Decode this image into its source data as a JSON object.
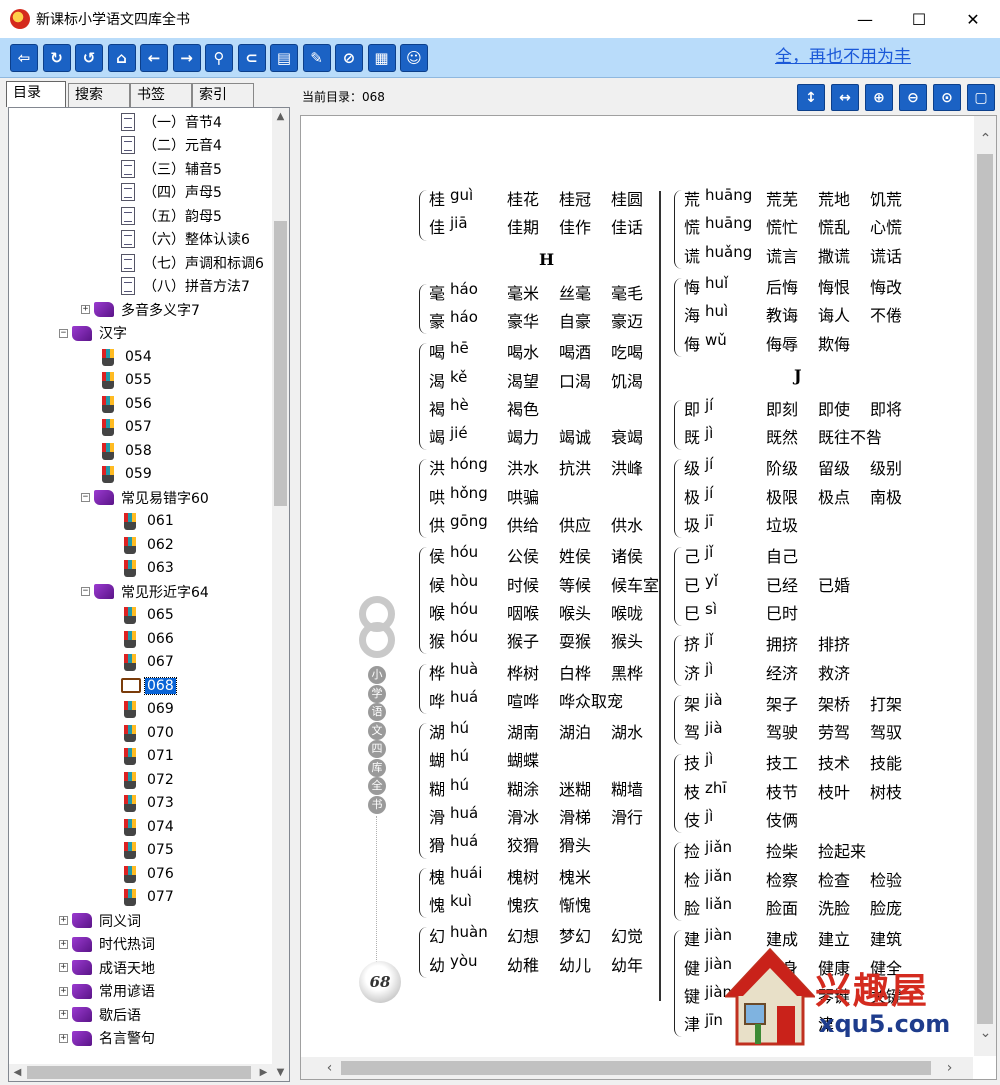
{
  "window": {
    "title": "新课标小学语文四库全书",
    "minimize": "—",
    "maximize": "☐",
    "close": "✕"
  },
  "toolbar": {
    "buttons": [
      {
        "name": "exit",
        "glyph": "⇦"
      },
      {
        "name": "refresh",
        "glyph": "↻"
      },
      {
        "name": "undo",
        "glyph": "↺"
      },
      {
        "name": "home",
        "glyph": "⌂"
      },
      {
        "name": "back",
        "glyph": "←"
      },
      {
        "name": "forward",
        "glyph": "→"
      },
      {
        "name": "search",
        "glyph": "⚲"
      },
      {
        "name": "bookmark",
        "glyph": "⊂"
      },
      {
        "name": "note",
        "glyph": "▤"
      },
      {
        "name": "edit",
        "glyph": "✎"
      },
      {
        "name": "link",
        "glyph": "⊘"
      },
      {
        "name": "print",
        "glyph": "▦"
      },
      {
        "name": "about",
        "glyph": "☺"
      }
    ],
    "marquee": "全，再也不用为丰"
  },
  "left": {
    "tabs": [
      "目录",
      "搜索",
      "书签",
      "索引"
    ],
    "active_tab": "目录"
  },
  "tree": [
    {
      "label": "（一）音节4",
      "icon": "page"
    },
    {
      "label": "（二）元音4",
      "icon": "page"
    },
    {
      "label": "（三）辅音5",
      "icon": "page"
    },
    {
      "label": "（四）声母5",
      "icon": "page"
    },
    {
      "label": "（五）韵母5",
      "icon": "page"
    },
    {
      "label": "（六）整体认读6",
      "icon": "page"
    },
    {
      "label": "（七）声调和标调6",
      "icon": "page"
    },
    {
      "label": "（八）拼音方法7",
      "icon": "page"
    },
    {
      "label": "多音多义字7",
      "icon": "book",
      "expander": "+"
    },
    {
      "label": "汉字",
      "icon": "book",
      "expander": "−"
    },
    {
      "label": "054",
      "icon": "pen"
    },
    {
      "label": "055",
      "icon": "pen"
    },
    {
      "label": "056",
      "icon": "pen"
    },
    {
      "label": "057",
      "icon": "pen"
    },
    {
      "label": "058",
      "icon": "pen"
    },
    {
      "label": "059",
      "icon": "pen"
    },
    {
      "label": "常见易错字60",
      "icon": "book",
      "expander": "−"
    },
    {
      "label": "061",
      "icon": "pen"
    },
    {
      "label": "062",
      "icon": "pen"
    },
    {
      "label": "063",
      "icon": "pen"
    },
    {
      "label": "常见形近字64",
      "icon": "book",
      "expander": "−"
    },
    {
      "label": "065",
      "icon": "pen"
    },
    {
      "label": "066",
      "icon": "pen"
    },
    {
      "label": "067",
      "icon": "pen"
    },
    {
      "label": "068",
      "icon": "open",
      "selected": true
    },
    {
      "label": "069",
      "icon": "pen"
    },
    {
      "label": "070",
      "icon": "pen"
    },
    {
      "label": "071",
      "icon": "pen"
    },
    {
      "label": "072",
      "icon": "pen"
    },
    {
      "label": "073",
      "icon": "pen"
    },
    {
      "label": "074",
      "icon": "pen"
    },
    {
      "label": "075",
      "icon": "pen"
    },
    {
      "label": "076",
      "icon": "pen"
    },
    {
      "label": "077",
      "icon": "pen"
    },
    {
      "label": "同义词",
      "icon": "book",
      "expander": "+"
    },
    {
      "label": "时代热词",
      "icon": "book",
      "expander": "+"
    },
    {
      "label": "成语天地",
      "icon": "book",
      "expander": "+"
    },
    {
      "label": "常用谚语",
      "icon": "book",
      "expander": "+"
    },
    {
      "label": "歇后语",
      "icon": "book",
      "expander": "+"
    },
    {
      "label": "名言警句",
      "icon": "book",
      "expander": "+"
    }
  ],
  "viewer": {
    "current_dir_label": "当前目录：",
    "current_dir": "068",
    "view_buttons": [
      {
        "name": "fit-height",
        "glyph": "↕"
      },
      {
        "name": "fit-width",
        "glyph": "↔"
      },
      {
        "name": "zoom-in",
        "glyph": "⊕"
      },
      {
        "name": "zoom-out",
        "glyph": "⊖"
      },
      {
        "name": "zoom-actual",
        "glyph": "⊙"
      },
      {
        "name": "fullscreen",
        "glyph": "▢"
      }
    ]
  },
  "page": {
    "page_number": "68",
    "book_title_vertical": [
      "小",
      "学",
      "语",
      "文",
      "四",
      "库",
      "全",
      "书"
    ],
    "left_column": [
      {
        "group": [
          {
            "hz": "桂",
            "py": "guì",
            "words": [
              "桂花",
              "桂冠",
              "桂圆"
            ]
          },
          {
            "hz": "佳",
            "py": "jiā",
            "words": [
              "佳期",
              "佳作",
              "佳话"
            ]
          }
        ]
      },
      {
        "section": "H"
      },
      {
        "group": [
          {
            "hz": "毫",
            "py": "háo",
            "words": [
              "毫米",
              "丝毫",
              "毫毛"
            ]
          },
          {
            "hz": "豪",
            "py": "háo",
            "words": [
              "豪华",
              "自豪",
              "豪迈"
            ]
          }
        ]
      },
      {
        "group": [
          {
            "hz": "喝",
            "py": "hē",
            "words": [
              "喝水",
              "喝酒",
              "吃喝"
            ]
          },
          {
            "hz": "渴",
            "py": "kě",
            "words": [
              "渴望",
              "口渴",
              "饥渴"
            ]
          },
          {
            "hz": "褐",
            "py": "hè",
            "words": [
              "褐色"
            ]
          },
          {
            "hz": "竭",
            "py": "jié",
            "words": [
              "竭力",
              "竭诚",
              "衰竭"
            ]
          }
        ]
      },
      {
        "group": [
          {
            "hz": "洪",
            "py": "hóng",
            "words": [
              "洪水",
              "抗洪",
              "洪峰"
            ]
          },
          {
            "hz": "哄",
            "py": "hǒng",
            "words": [
              "哄骗"
            ]
          },
          {
            "hz": "供",
            "py": "gōng",
            "words": [
              "供给",
              "供应",
              "供水"
            ]
          }
        ]
      },
      {
        "group": [
          {
            "hz": "侯",
            "py": "hóu",
            "words": [
              "公侯",
              "姓侯",
              "诸侯"
            ]
          },
          {
            "hz": "候",
            "py": "hòu",
            "words": [
              "时候",
              "等候",
              "候车室"
            ]
          },
          {
            "hz": "喉",
            "py": "hóu",
            "words": [
              "咽喉",
              "喉头",
              "喉咙"
            ]
          },
          {
            "hz": "猴",
            "py": "hóu",
            "words": [
              "猴子",
              "耍猴",
              "猴头"
            ]
          }
        ]
      },
      {
        "group": [
          {
            "hz": "桦",
            "py": "huà",
            "words": [
              "桦树",
              "白桦",
              "黑桦"
            ]
          },
          {
            "hz": "哗",
            "py": "huá",
            "words": [
              "喧哗",
              "哗众取宠"
            ]
          }
        ]
      },
      {
        "group": [
          {
            "hz": "湖",
            "py": "hú",
            "words": [
              "湖南",
              "湖泊",
              "湖水"
            ]
          },
          {
            "hz": "蝴",
            "py": "hú",
            "words": [
              "蝴蝶"
            ]
          },
          {
            "hz": "糊",
            "py": "hú",
            "words": [
              "糊涂",
              "迷糊",
              "糊墙"
            ]
          },
          {
            "hz": "滑",
            "py": "huá",
            "words": [
              "滑冰",
              "滑梯",
              "滑行"
            ]
          },
          {
            "hz": "猾",
            "py": "huá",
            "words": [
              "狡猾",
              "猾头"
            ]
          }
        ]
      },
      {
        "group": [
          {
            "hz": "槐",
            "py": "huái",
            "words": [
              "槐树",
              "槐米"
            ]
          },
          {
            "hz": "愧",
            "py": "kuì",
            "words": [
              "愧疚",
              "惭愧"
            ]
          }
        ]
      },
      {
        "group": [
          {
            "hz": "幻",
            "py": "huàn",
            "words": [
              "幻想",
              "梦幻",
              "幻觉"
            ]
          },
          {
            "hz": "幼",
            "py": "yòu",
            "words": [
              "幼稚",
              "幼儿",
              "幼年"
            ]
          }
        ]
      }
    ],
    "right_column": [
      {
        "group": [
          {
            "hz": "荒",
            "py": "huāng",
            "words": [
              "荒芜",
              "荒地",
              "饥荒"
            ]
          },
          {
            "hz": "慌",
            "py": "huāng",
            "words": [
              "慌忙",
              "慌乱",
              "心慌"
            ]
          },
          {
            "hz": "谎",
            "py": "huǎng",
            "words": [
              "谎言",
              "撒谎",
              "谎话"
            ]
          }
        ]
      },
      {
        "group": [
          {
            "hz": "悔",
            "py": "huǐ",
            "words": [
              "后悔",
              "悔恨",
              "悔改"
            ]
          },
          {
            "hz": "海",
            "py": "huì",
            "words": [
              "教诲",
              "诲人",
              "不倦"
            ]
          },
          {
            "hz": "侮",
            "py": "wǔ",
            "words": [
              "侮辱",
              "欺侮"
            ]
          }
        ]
      },
      {
        "section": "J"
      },
      {
        "group": [
          {
            "hz": "即",
            "py": "jí",
            "words": [
              "即刻",
              "即使",
              "即将"
            ]
          },
          {
            "hz": "既",
            "py": "jì",
            "words": [
              "既然",
              "既往不咎"
            ]
          }
        ]
      },
      {
        "group": [
          {
            "hz": "级",
            "py": "jí",
            "words": [
              "阶级",
              "留级",
              "级别"
            ]
          },
          {
            "hz": "极",
            "py": "jí",
            "words": [
              "极限",
              "极点",
              "南极"
            ]
          },
          {
            "hz": "圾",
            "py": "jī",
            "words": [
              "垃圾"
            ]
          }
        ]
      },
      {
        "group": [
          {
            "hz": "己",
            "py": "jǐ",
            "words": [
              "自己"
            ]
          },
          {
            "hz": "已",
            "py": "yǐ",
            "words": [
              "已经",
              "已婚"
            ]
          },
          {
            "hz": "巳",
            "py": "sì",
            "words": [
              "巳时"
            ]
          }
        ]
      },
      {
        "group": [
          {
            "hz": "挤",
            "py": "jǐ",
            "words": [
              "拥挤",
              "排挤"
            ]
          },
          {
            "hz": "济",
            "py": "jì",
            "words": [
              "经济",
              "救济"
            ]
          }
        ]
      },
      {
        "group": [
          {
            "hz": "架",
            "py": "jià",
            "words": [
              "架子",
              "架桥",
              "打架"
            ]
          },
          {
            "hz": "驾",
            "py": "jià",
            "words": [
              "驾驶",
              "劳驾",
              "驾驭"
            ]
          }
        ]
      },
      {
        "group": [
          {
            "hz": "技",
            "py": "jì",
            "words": [
              "技工",
              "技术",
              "技能"
            ]
          },
          {
            "hz": "枝",
            "py": "zhī",
            "words": [
              "枝节",
              "枝叶",
              "树枝"
            ]
          },
          {
            "hz": "伎",
            "py": "jì",
            "words": [
              "伎俩"
            ]
          }
        ]
      },
      {
        "group": [
          {
            "hz": "捡",
            "py": "jiǎn",
            "words": [
              "捡柴",
              "捡起来"
            ]
          },
          {
            "hz": "检",
            "py": "jiǎn",
            "words": [
              "检察",
              "检查",
              "检验"
            ]
          },
          {
            "hz": "脸",
            "py": "liǎn",
            "words": [
              "脸面",
              "洗脸",
              "脸庞"
            ]
          }
        ]
      },
      {
        "group": [
          {
            "hz": "建",
            "py": "jiàn",
            "words": [
              "建成",
              "建立",
              "建筑"
            ]
          },
          {
            "hz": "健",
            "py": "jiàn",
            "words": [
              "健身",
              "健康",
              "健全"
            ]
          },
          {
            "hz": "键",
            "py": "jiàn",
            "words": [
              "键盘",
              "琴键",
              "关键"
            ]
          },
          {
            "hz": "津",
            "py": "jīn",
            "words": [
              "",
              "津"
            ]
          }
        ]
      }
    ]
  },
  "watermark": {
    "text": "兴趣屋",
    "url": "xqu5.com"
  },
  "colors": {
    "toolbar_bg": "#b9dcfa",
    "button_blue": "#1b62c4",
    "selection": "#0a64d6",
    "marquee": "#1a58d8",
    "watermark_red": "#d42b1f",
    "watermark_blue": "#1e3c8c"
  }
}
